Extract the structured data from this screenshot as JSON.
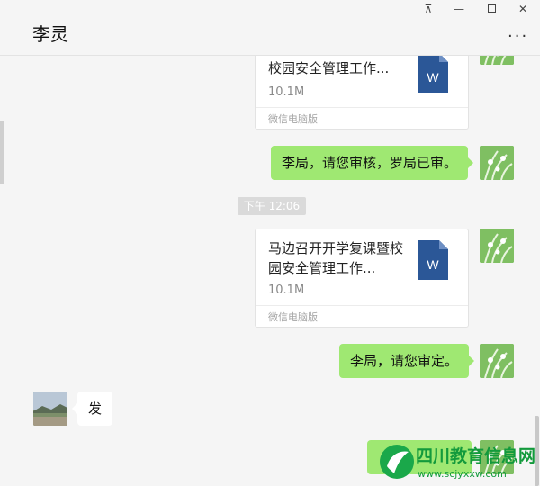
{
  "header": {
    "title": "李灵",
    "pin_glyph": "⊼",
    "minimize_glyph": "—",
    "close_glyph": "✕",
    "more_glyph": "···"
  },
  "messages": {
    "file_top": {
      "name": "校园安全管理工作...",
      "size": "10.1M",
      "source": "微信电脑版",
      "icon_letter": "W"
    },
    "sent_1": {
      "text": "李局，请您审核，罗局已审。"
    },
    "timestamp": "下午 12:06",
    "file_2": {
      "name": "马边召开开学复课暨校园安全管理工作...",
      "size": "10.1M",
      "source": "微信电脑版",
      "icon_letter": "W"
    },
    "sent_2": {
      "text": "李局，请您审定。"
    },
    "received_1": {
      "text": "发"
    }
  },
  "watermark": {
    "name": "四川教育信息网",
    "url": "www.scjyxxw.com"
  },
  "colors": {
    "background": "#f5f5f5",
    "sent_bubble": "#9fe872",
    "received_bubble": "#ffffff",
    "word_icon": "#2b5797",
    "watermark_green": "#139a3c"
  },
  "icons": {
    "pin": "pin-icon",
    "minimize": "minimize-icon",
    "maximize": "maximize-icon",
    "close": "close-icon",
    "more": "more-icon",
    "document": "word-document-icon"
  }
}
